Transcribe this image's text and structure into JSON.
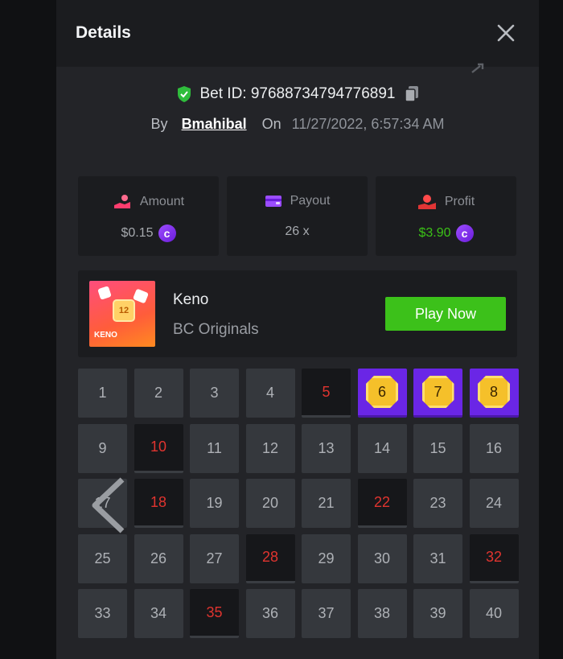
{
  "header": {
    "title": "Details",
    "close_icon": "close-icon"
  },
  "bet": {
    "id_label": "Bet ID:",
    "id_value": "97688734794776891",
    "by_label": "By",
    "user": "Bmahibal",
    "on_label": "On",
    "datetime": "11/27/2022, 6:57:34 AM"
  },
  "stats": [
    {
      "label": "Amount",
      "value": "$0.15",
      "icon": "hand-money-icon",
      "color": "#a6a9ae"
    },
    {
      "label": "Payout",
      "value": "26 x",
      "icon": "wallet-icon",
      "color": "#a6a9ae"
    },
    {
      "label": "Profit",
      "value": "$3.90",
      "icon": "profit-hand-icon",
      "color": "#3bc117"
    }
  ],
  "game": {
    "name": "Keno",
    "provider": "BC Originals",
    "thumb_label": "KENO",
    "thumb_ball": "12",
    "play_label": "Play Now"
  },
  "colors": {
    "accent": "#3cc11a",
    "hit": "#6a26e6",
    "miss_text": "#e0342f",
    "gem": "#f5c02a"
  },
  "grid": [
    {
      "n": "1",
      "s": "n"
    },
    {
      "n": "2",
      "s": "n"
    },
    {
      "n": "3",
      "s": "n"
    },
    {
      "n": "4",
      "s": "n"
    },
    {
      "n": "5",
      "s": "m"
    },
    {
      "n": "6",
      "s": "h"
    },
    {
      "n": "7",
      "s": "h"
    },
    {
      "n": "8",
      "s": "h"
    },
    {
      "n": "9",
      "s": "n"
    },
    {
      "n": "10",
      "s": "m"
    },
    {
      "n": "11",
      "s": "n"
    },
    {
      "n": "12",
      "s": "n"
    },
    {
      "n": "13",
      "s": "n"
    },
    {
      "n": "14",
      "s": "n"
    },
    {
      "n": "15",
      "s": "n"
    },
    {
      "n": "16",
      "s": "n"
    },
    {
      "n": "17",
      "s": "n"
    },
    {
      "n": "18",
      "s": "m"
    },
    {
      "n": "19",
      "s": "n"
    },
    {
      "n": "20",
      "s": "n"
    },
    {
      "n": "21",
      "s": "n"
    },
    {
      "n": "22",
      "s": "m"
    },
    {
      "n": "23",
      "s": "n"
    },
    {
      "n": "24",
      "s": "n"
    },
    {
      "n": "25",
      "s": "n"
    },
    {
      "n": "26",
      "s": "n"
    },
    {
      "n": "27",
      "s": "n"
    },
    {
      "n": "28",
      "s": "m"
    },
    {
      "n": "29",
      "s": "n"
    },
    {
      "n": "30",
      "s": "n"
    },
    {
      "n": "31",
      "s": "n"
    },
    {
      "n": "32",
      "s": "m"
    },
    {
      "n": "33",
      "s": "n"
    },
    {
      "n": "34",
      "s": "n"
    },
    {
      "n": "35",
      "s": "m"
    },
    {
      "n": "36",
      "s": "n"
    },
    {
      "n": "37",
      "s": "n"
    },
    {
      "n": "38",
      "s": "n"
    },
    {
      "n": "39",
      "s": "n"
    },
    {
      "n": "40",
      "s": "n"
    }
  ]
}
